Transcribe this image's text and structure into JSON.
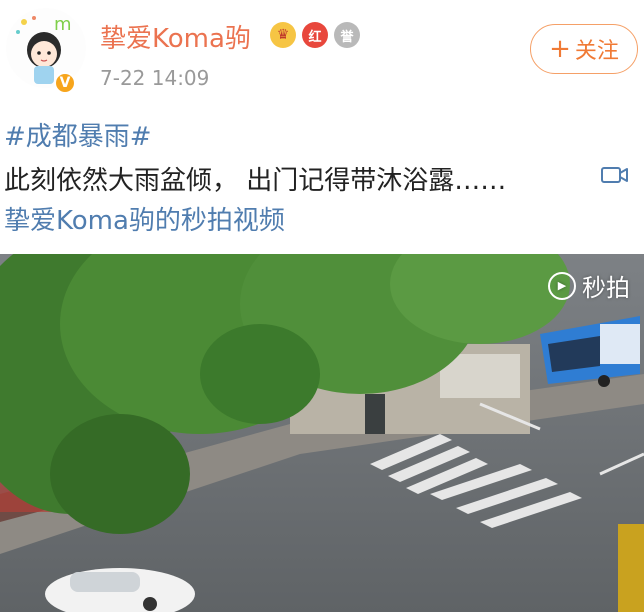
{
  "post": {
    "username": "挚爱Koma驹",
    "timestamp": "7-22 14:09",
    "follow_label": "关注",
    "hashtag": "#成都暴雨#",
    "text": "此刻依然大雨盆倾， 出门记得带沐浴露……",
    "video_link": "挚爱Koma驹的秒拍视频",
    "verified_badge": "V",
    "badges": [
      {
        "icon": "crown-icon",
        "color": "#f6c544"
      },
      {
        "icon": "red-badge-icon",
        "text": "红",
        "color": "#e8473c"
      },
      {
        "icon": "medal-icon",
        "text": "誉",
        "color": "#b9b9b9"
      }
    ]
  },
  "video": {
    "watermark": "秒拍",
    "watermark_icon": "play-circle-icon"
  },
  "colors": {
    "username": "#eb7350",
    "link": "#507daf",
    "follow_border": "#f5a067",
    "timestamp": "#999999"
  }
}
